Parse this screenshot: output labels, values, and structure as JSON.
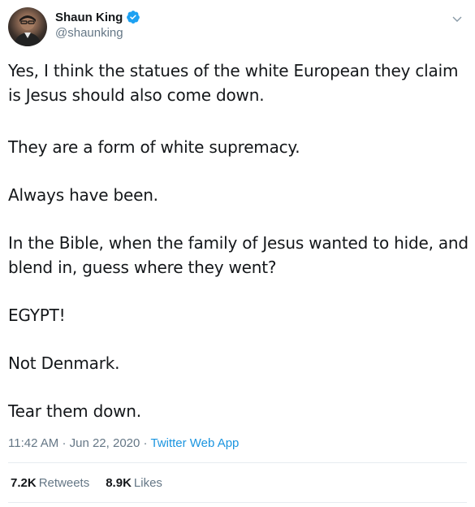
{
  "author": {
    "name": "Shaun King",
    "handle": "@shaunking"
  },
  "tweet": {
    "paragraphs": [
      "Yes, I think the statues of the white European they claim is Jesus should also come down.",
      "They are a form of white supremacy.",
      "Always have been.",
      "In the Bible, when the family of Jesus wanted to hide, and blend in, guess where they went?",
      "EGYPT!",
      "Not Denmark.",
      "Tear them down."
    ],
    "time": "11:42 AM",
    "separator1": "·",
    "date": "Jun 22, 2020",
    "separator2": "·",
    "source": "Twitter Web App"
  },
  "stats": {
    "retweets_count": "7.2K",
    "retweets_label": "Retweets",
    "likes_count": "8.9K",
    "likes_label": "Likes"
  },
  "colors": {
    "verified": "#1da1f2",
    "link": "#1b95e0",
    "muted": "#657786",
    "text": "#14171a",
    "divider": "#e6ecf0"
  },
  "icons": {
    "verified": "verified-badge-icon",
    "menu": "chevron-down-icon"
  }
}
